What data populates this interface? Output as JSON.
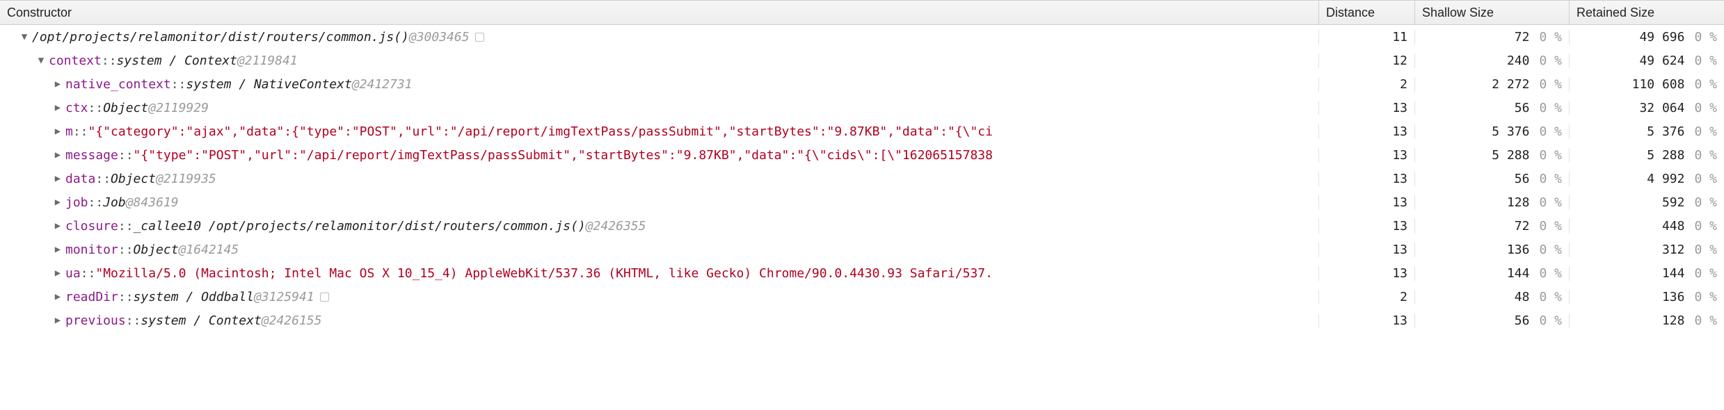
{
  "columns": {
    "constructor": "Constructor",
    "distance": "Distance",
    "shallow": "Shallow Size",
    "retained": "Retained Size"
  },
  "rows": [
    {
      "indent": 28,
      "tri": "▼",
      "name": "",
      "sep": "",
      "classText": "/opt/projects/relamonitor/dist/routers/common.js()",
      "addr": "@3003465",
      "badge": true,
      "distance": "11",
      "shallow": "72",
      "shallowPct": "0 %",
      "retained": "49 696",
      "retainedPct": "0 %"
    },
    {
      "indent": 52,
      "tri": "▼",
      "name": "context",
      "sep": " :: ",
      "classText": "system / Context",
      "addr": "@2119841",
      "distance": "12",
      "shallow": "240",
      "shallowPct": "0 %",
      "retained": "49 624",
      "retainedPct": "0 %"
    },
    {
      "indent": 76,
      "tri": "▶",
      "name": "native_context",
      "sep": " :: ",
      "classText": "system / NativeContext",
      "addr": "@2412731",
      "distance": "2",
      "shallow": "2 272",
      "shallowPct": "0 %",
      "retained": "110 608",
      "retainedPct": "0 %"
    },
    {
      "indent": 76,
      "tri": "▶",
      "name": "ctx",
      "sep": " :: ",
      "classText": "Object",
      "addr": "@2119929",
      "distance": "13",
      "shallow": "56",
      "shallowPct": "0 %",
      "retained": "32 064",
      "retainedPct": "0 %"
    },
    {
      "indent": 76,
      "tri": "▶",
      "name": "m",
      "sep": " :: ",
      "strVal": "\"{\"category\":\"ajax\",\"data\":{\"type\":\"POST\",\"url\":\"/api/report/imgTextPass/passSubmit\",\"startBytes\":\"9.87KB\",\"data\":\"{\\\"ci",
      "distance": "13",
      "shallow": "5 376",
      "shallowPct": "0 %",
      "retained": "5 376",
      "retainedPct": "0 %"
    },
    {
      "indent": 76,
      "tri": "▶",
      "name": "message",
      "sep": " :: ",
      "strVal": "\"{\"type\":\"POST\",\"url\":\"/api/report/imgTextPass/passSubmit\",\"startBytes\":\"9.87KB\",\"data\":\"{\\\"cids\\\":[\\\"162065157838",
      "distance": "13",
      "shallow": "5 288",
      "shallowPct": "0 %",
      "retained": "5 288",
      "retainedPct": "0 %"
    },
    {
      "indent": 76,
      "tri": "▶",
      "name": "data",
      "sep": " :: ",
      "classText": "Object",
      "addr": "@2119935",
      "distance": "13",
      "shallow": "56",
      "shallowPct": "0 %",
      "retained": "4 992",
      "retainedPct": "0 %"
    },
    {
      "indent": 76,
      "tri": "▶",
      "name": "job",
      "sep": " :: ",
      "classText": "Job",
      "addr": "@843619",
      "distance": "13",
      "shallow": "128",
      "shallowPct": "0 %",
      "retained": "592",
      "retainedPct": "0 %"
    },
    {
      "indent": 76,
      "tri": "▶",
      "name": "closure",
      "sep": " :: ",
      "classText": "_callee10 /opt/projects/relamonitor/dist/routers/common.js()",
      "addr": "@2426355",
      "distance": "13",
      "shallow": "72",
      "shallowPct": "0 %",
      "retained": "448",
      "retainedPct": "0 %"
    },
    {
      "indent": 76,
      "tri": "▶",
      "name": "monitor",
      "sep": " :: ",
      "classText": "Object",
      "addr": "@1642145",
      "distance": "13",
      "shallow": "136",
      "shallowPct": "0 %",
      "retained": "312",
      "retainedPct": "0 %"
    },
    {
      "indent": 76,
      "tri": "▶",
      "name": "ua",
      "sep": " :: ",
      "strVal": "\"Mozilla/5.0 (Macintosh; Intel Mac OS X 10_15_4) AppleWebKit/537.36 (KHTML, like Gecko) Chrome/90.0.4430.93 Safari/537.",
      "distance": "13",
      "shallow": "144",
      "shallowPct": "0 %",
      "retained": "144",
      "retainedPct": "0 %"
    },
    {
      "indent": 76,
      "tri": "▶",
      "name": "readDir",
      "sep": " :: ",
      "classText": "system / Oddball",
      "addr": "@3125941",
      "badge": true,
      "distance": "2",
      "shallow": "48",
      "shallowPct": "0 %",
      "retained": "136",
      "retainedPct": "0 %"
    },
    {
      "indent": 76,
      "tri": "▶",
      "name": "previous",
      "sep": " :: ",
      "classText": "system / Context",
      "addr": "@2426155",
      "distance": "13",
      "shallow": "56",
      "shallowPct": "0 %",
      "retained": "128",
      "retainedPct": "0 %"
    }
  ]
}
